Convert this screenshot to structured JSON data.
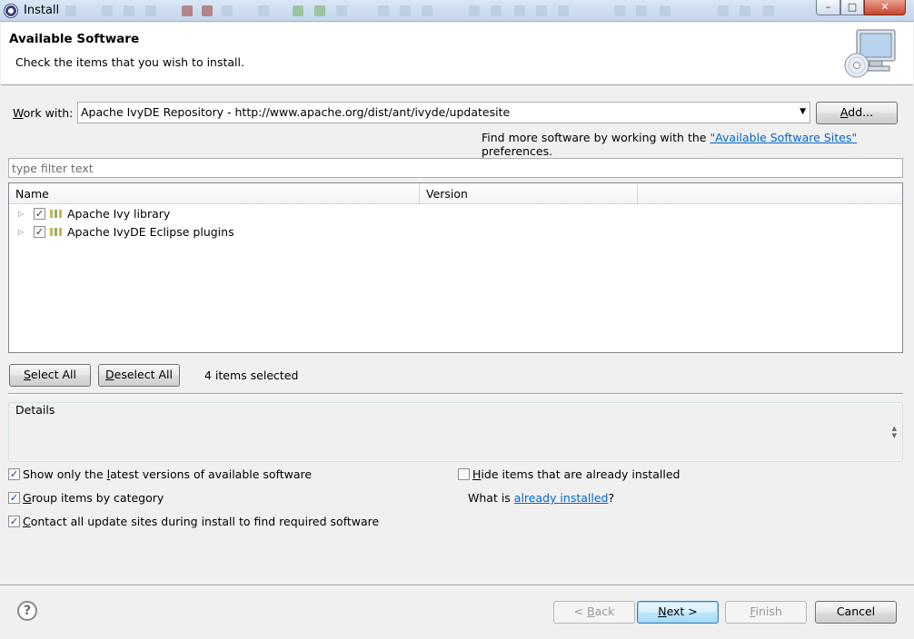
{
  "window": {
    "title": "Install",
    "controls": {
      "minimize": "–",
      "maximize": "□",
      "close": "✕"
    }
  },
  "header": {
    "title": "Available Software",
    "subtitle": "Check the items that you wish to install.",
    "banner_icon": "monitor-cd-icon"
  },
  "work_with": {
    "label_underlined": "W",
    "label_rest": "ork with:",
    "value": "Apache IvyDE Repository - http://www.apache.org/dist/ant/ivyde/updatesite",
    "add_button_underlined": "A",
    "add_button_rest": "dd...",
    "find_more_prefix": "Find more software by working with the ",
    "find_more_link": "\"Available Software Sites\"",
    "find_more_suffix": " preferences."
  },
  "filter": {
    "placeholder": "type filter text",
    "value": ""
  },
  "tree": {
    "columns": [
      "Name",
      "Version"
    ],
    "rows": [
      {
        "label": "Apache Ivy library",
        "checked": true,
        "icon": "category-icon"
      },
      {
        "label": "Apache IvyDE Eclipse plugins",
        "checked": true,
        "icon": "category-icon"
      }
    ]
  },
  "selection": {
    "select_all_underlined": "S",
    "select_all_rest": "elect All",
    "deselect_all_underlined": "D",
    "deselect_all_rest": "eselect All",
    "status": "4 items selected"
  },
  "details": {
    "label": "Details",
    "text": ""
  },
  "options": {
    "show_latest_pre": "Show only the ",
    "show_latest_u": "l",
    "show_latest_post": "atest versions of available software",
    "show_latest_checked": true,
    "group_u": "G",
    "group_post": "roup items by category",
    "group_checked": true,
    "contact_u": "C",
    "contact_post": "ontact all update sites during install to find required software",
    "contact_checked": true,
    "hide_u": "H",
    "hide_post": "ide items that are already installed",
    "hide_checked": false,
    "what_is_prefix": "What is ",
    "what_is_link": "already installed",
    "what_is_suffix": "?"
  },
  "footer": {
    "help": "?",
    "back_pre": "< ",
    "back_u": "B",
    "back_post": "ack",
    "next_u": "N",
    "next_post": "ext >",
    "finish_u": "F",
    "finish_post": "inish",
    "cancel": "Cancel"
  },
  "colors": {
    "link": "#0066cc",
    "titlebar": "#c4d6ec",
    "dialog_bg": "#f0f0f0"
  }
}
